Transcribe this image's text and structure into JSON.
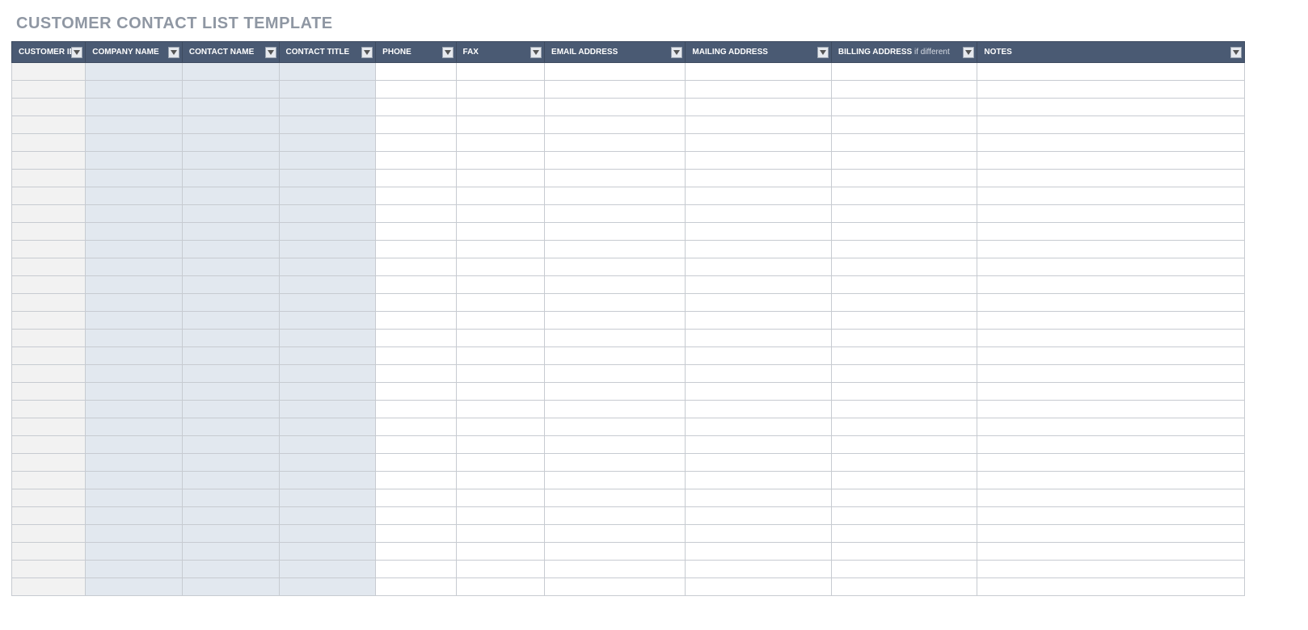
{
  "title": "CUSTOMER CONTACT LIST TEMPLATE",
  "columns": [
    {
      "label": "CUSTOMER ID",
      "sub": "",
      "shade": "a"
    },
    {
      "label": "COMPANY NAME",
      "sub": "",
      "shade": "b"
    },
    {
      "label": "CONTACT NAME",
      "sub": "",
      "shade": "b"
    },
    {
      "label": "CONTACT TITLE",
      "sub": "",
      "shade": "b"
    },
    {
      "label": "PHONE",
      "sub": "",
      "shade": "c"
    },
    {
      "label": "FAX",
      "sub": "",
      "shade": "c"
    },
    {
      "label": "EMAIL ADDRESS",
      "sub": "",
      "shade": "c"
    },
    {
      "label": "MAILING ADDRESS",
      "sub": "",
      "shade": "c"
    },
    {
      "label": "BILLING ADDRESS",
      "sub": "if different",
      "shade": "c"
    },
    {
      "label": "NOTES",
      "sub": "",
      "shade": "c"
    }
  ],
  "row_count": 30,
  "colors": {
    "header_bg": "#4a5a73",
    "title_color": "#8f97a3",
    "shade_a": "#f2f2f2",
    "shade_b": "#e2e8ef",
    "shade_c": "#ffffff"
  }
}
